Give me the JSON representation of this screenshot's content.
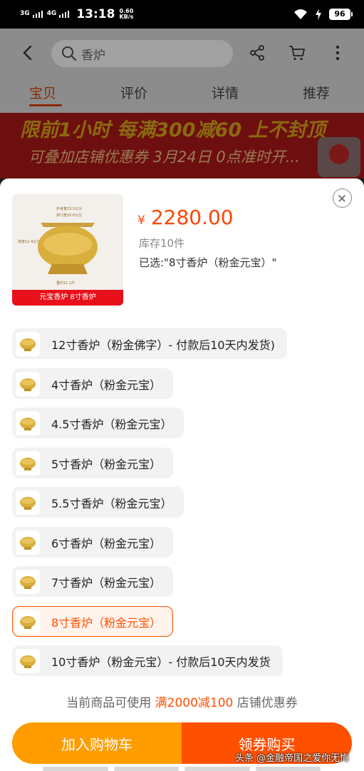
{
  "status_bar": {
    "net1": "3G",
    "net2": "4G",
    "time": "13:18",
    "speed_value": "0.60",
    "speed_unit": "KB/s",
    "battery": "96"
  },
  "header": {
    "search_text": "香炉",
    "tabs": [
      {
        "label": "宝贝",
        "active": true
      },
      {
        "label": "评价",
        "active": false
      },
      {
        "label": "详情",
        "active": false
      },
      {
        "label": "推荐",
        "active": false
      }
    ]
  },
  "banner": {
    "line1": "限前1小时 每满300减60 上不封顶",
    "line2": "可叠加店铺优惠券 3月24日 0点准时开..."
  },
  "sheet": {
    "image_caption": "元宝香炉 8寸香炉",
    "image_dims": [
      "炉身宽23.5公分",
      "炉口宽20.6公分",
      "高度12.4公分",
      "重约11.2斤"
    ],
    "currency": "¥",
    "price": "2280.00",
    "stock": "库存10件",
    "selected": "已选:\"8寸香炉（粉金元宝）\"",
    "options": [
      {
        "label": "12寸香炉（粉金佛字）- 付款后10天内发货)",
        "selected": false
      },
      {
        "label": "4寸香炉（粉金元宝）",
        "selected": false
      },
      {
        "label": "4.5寸香炉（粉金元宝）",
        "selected": false
      },
      {
        "label": "5寸香炉（粉金元宝）",
        "selected": false
      },
      {
        "label": "5.5寸香炉（粉金元宝）",
        "selected": false
      },
      {
        "label": "6寸香炉（粉金元宝）",
        "selected": false
      },
      {
        "label": "7寸香炉（粉金元宝）",
        "selected": false
      },
      {
        "label": "8寸香炉（粉金元宝）",
        "selected": true
      },
      {
        "label": "10寸香炉（粉金元宝）- 付款后10天内发货",
        "selected": false
      }
    ],
    "coupon_prefix": "当前商品可使用",
    "coupon_highlight": "满2000减100",
    "coupon_suffix": "店铺优惠券",
    "add_to_cart": "加入购物车",
    "buy_with_coupon": "领券购买"
  },
  "watermark": "头条 @金融帝国之爱你无悔",
  "colors": {
    "accent": "#ff5000",
    "cart_button": "#ff9d00",
    "price": "#ff4400"
  }
}
